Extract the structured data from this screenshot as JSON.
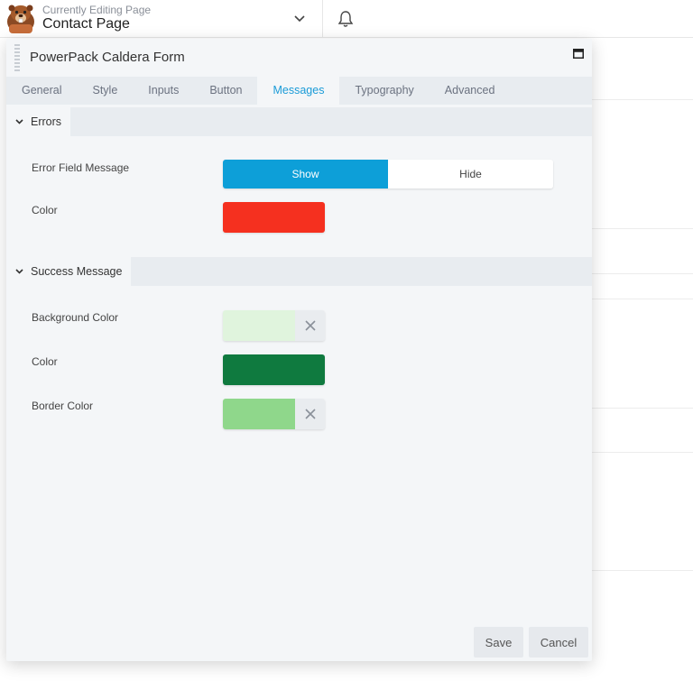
{
  "topbar": {
    "editing_label": "Currently Editing Page",
    "page_name": "Contact Page",
    "dropdown_icon": "chevron-down-icon",
    "notifications_icon": "bell-icon"
  },
  "panel": {
    "title": "PowerPack Caldera Form",
    "tabs": [
      {
        "label": "General"
      },
      {
        "label": "Style"
      },
      {
        "label": "Inputs"
      },
      {
        "label": "Button"
      },
      {
        "label": "Messages"
      },
      {
        "label": "Typography"
      },
      {
        "label": "Advanced"
      }
    ],
    "active_tab": "Messages",
    "sections": {
      "errors": {
        "title": "Errors",
        "error_field_message_label": "Error Field Message",
        "toggle_options": [
          "Show",
          "Hide"
        ],
        "toggle_selected": "Show",
        "color_label": "Color",
        "color_value": "#f5301f"
      },
      "success": {
        "title": "Success Message",
        "background_color_label": "Background Color",
        "background_color_value": "#e0f4dd",
        "color_label": "Color",
        "color_value": "#0f7a3f",
        "border_color_label": "Border Color",
        "border_color_value": "#8fd78b"
      }
    },
    "footer": {
      "save_label": "Save",
      "cancel_label": "Cancel"
    }
  },
  "colors": {
    "accent": "#0d9fd8",
    "tab_active_text": "#1a9bd7"
  }
}
